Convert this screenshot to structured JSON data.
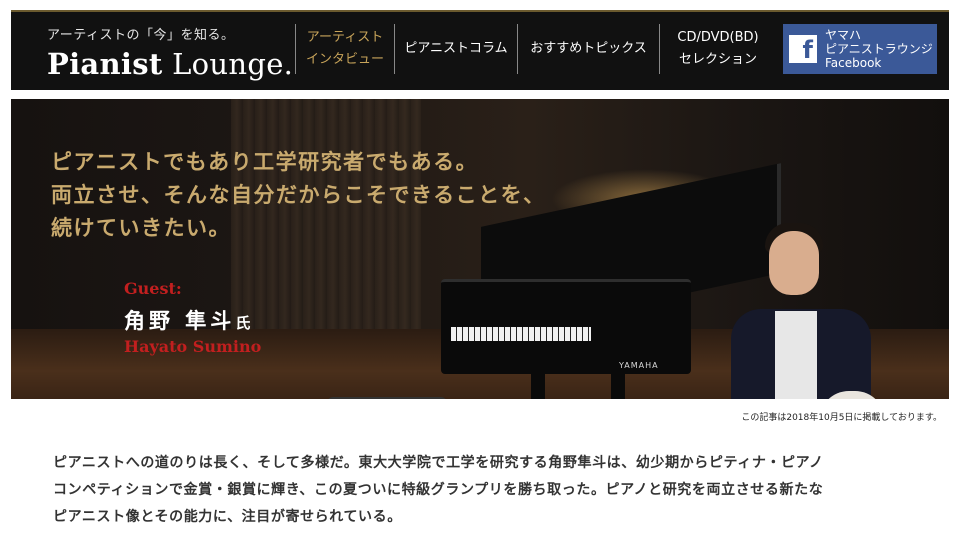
{
  "header": {
    "tagline": "アーティストの「今」を知る。",
    "logo_bold": "Pianist",
    "logo_light": "Lounge.",
    "nav": [
      {
        "line1": "アーティスト",
        "line2": "インタビュー",
        "active": true
      },
      {
        "line1": "ピアニストコラム",
        "line2": ""
      },
      {
        "line1": "おすすめトピックス",
        "line2": ""
      },
      {
        "line1": "CD/DVD(BD)",
        "line2": "セレクション"
      }
    ],
    "facebook": {
      "icon": "f",
      "line1": "ヤマハ",
      "line2": "ピアニストラウンジ",
      "line3": "Facebook"
    }
  },
  "hero": {
    "headline": [
      "ピアニストでもあり工学研究者でもある。",
      "両立させ、そんな自分だからこそできることを、",
      "続けていきたい。"
    ],
    "guest_label": "Guest:",
    "guest_name": "角野 隼斗",
    "guest_honorific": "氏",
    "guest_roman": "Hayato Sumino",
    "piano_brand": "YAMAHA"
  },
  "article": {
    "published": "この記事は2018年10月5日に掲載しております。",
    "intro": [
      "ピアニストへの道のりは長く、そして多様だ。東大大学院で工学を研究する角野隼斗は、幼少期からピティナ・ピアノ",
      "コンペティションで金賞・銀賞に輝き、この夏ついに特級グランプリを勝ち取った。ピアノと研究を両立させる新たな",
      "ピアニスト像とその能力に、注目が寄せられている。"
    ]
  },
  "colors": {
    "header_bg": "#111111",
    "accent_gold": "#c9aa6e",
    "accent_red": "#c21f1f",
    "facebook_blue": "#3b5998"
  }
}
